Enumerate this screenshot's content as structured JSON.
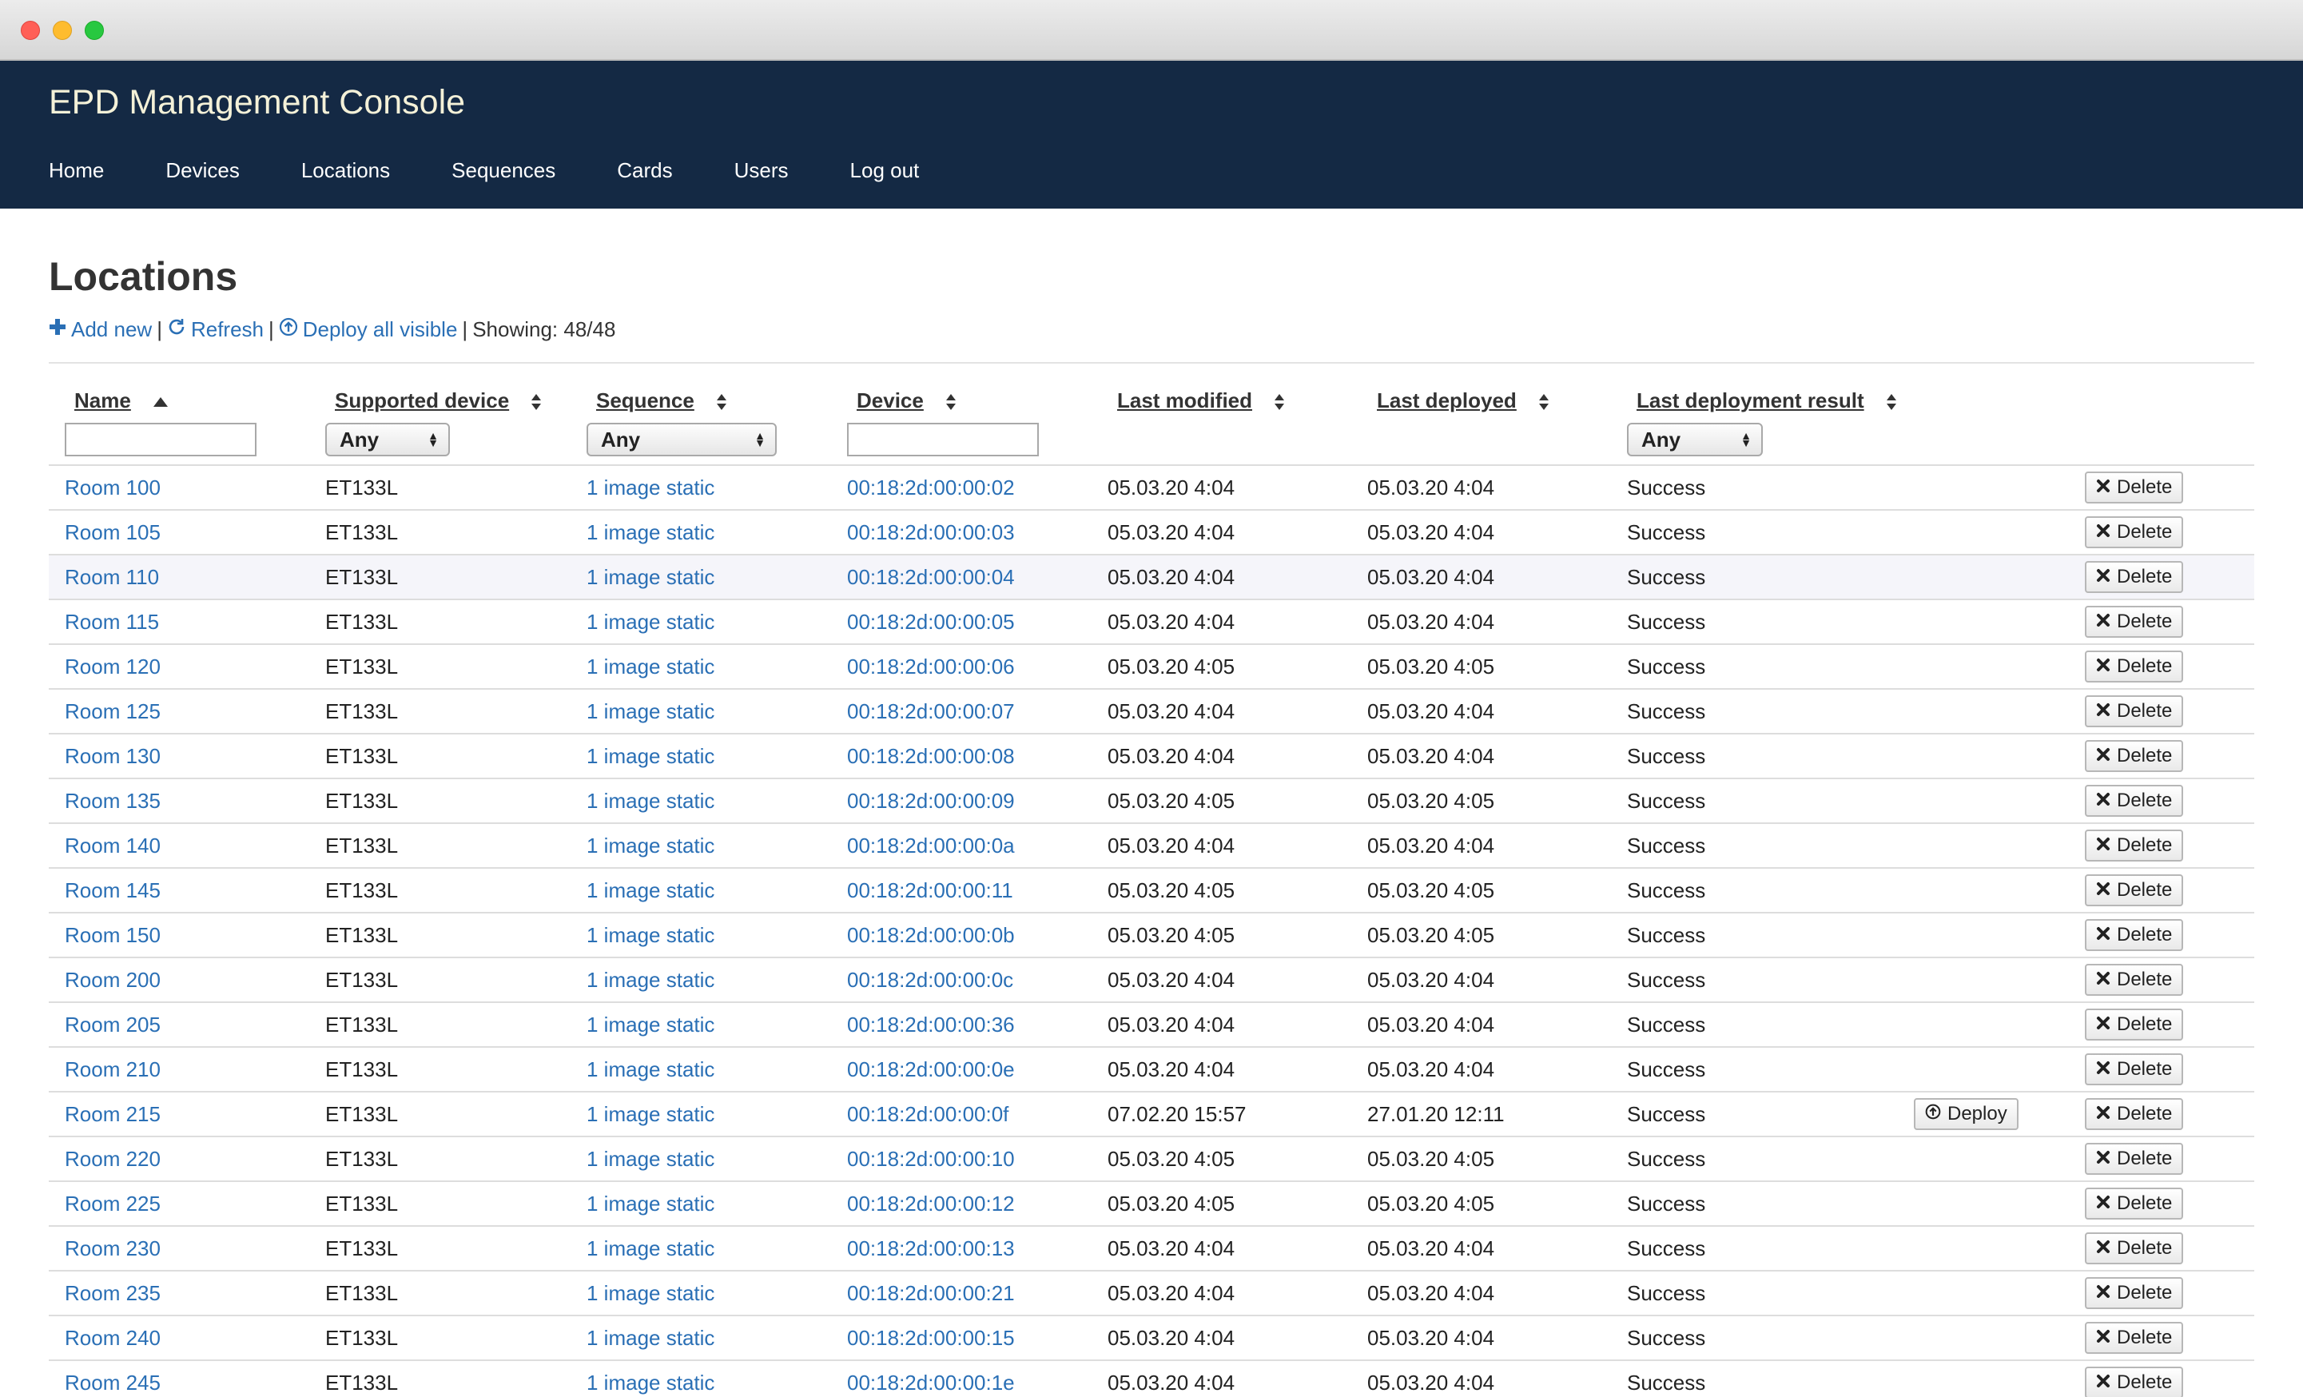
{
  "app": {
    "title": "EPD Management Console"
  },
  "nav": {
    "items": [
      {
        "label": "Home"
      },
      {
        "label": "Devices"
      },
      {
        "label": "Locations"
      },
      {
        "label": "Sequences"
      },
      {
        "label": "Cards"
      },
      {
        "label": "Users"
      },
      {
        "label": "Log out"
      }
    ]
  },
  "page": {
    "title": "Locations"
  },
  "toolbar": {
    "add_new": "Add new",
    "refresh": "Refresh",
    "deploy_all": "Deploy all visible",
    "showing": "Showing: 48/48",
    "separator": "|"
  },
  "icons": {
    "add": "plus-icon",
    "refresh": "refresh-icon",
    "deploy": "upload-circle-icon",
    "delete": "x-mark-icon",
    "sort": "sort-icon",
    "sort_asc": "sort-ascending-icon"
  },
  "colors": {
    "header_bg": "#142944",
    "link": "#2a6fb5",
    "success": "#1a8a1a",
    "brand_text": "#f4f1d8"
  },
  "table": {
    "columns": [
      {
        "label": "Name"
      },
      {
        "label": "Supported device"
      },
      {
        "label": "Sequence"
      },
      {
        "label": "Device"
      },
      {
        "label": "Last modified"
      },
      {
        "label": "Last deployed"
      },
      {
        "label": "Last deployment result"
      }
    ],
    "filters": {
      "name_value": "",
      "supported_device_selected": "Any",
      "sequence_selected": "Any",
      "device_value": "",
      "result_selected": "Any"
    },
    "actions": {
      "delete_label": "Delete",
      "deploy_label": "Deploy"
    },
    "rows": [
      {
        "name": "Room 100",
        "supported": "ET133L",
        "sequence": "1 image static",
        "device": "00:18:2d:00:00:02",
        "modified": "05.03.20 4:04",
        "deployed": "05.03.20 4:04",
        "result": "Success",
        "deploy": false
      },
      {
        "name": "Room 105",
        "supported": "ET133L",
        "sequence": "1 image static",
        "device": "00:18:2d:00:00:03",
        "modified": "05.03.20 4:04",
        "deployed": "05.03.20 4:04",
        "result": "Success",
        "deploy": false
      },
      {
        "name": "Room 110",
        "supported": "ET133L",
        "sequence": "1 image static",
        "device": "00:18:2d:00:00:04",
        "modified": "05.03.20 4:04",
        "deployed": "05.03.20 4:04",
        "result": "Success",
        "deploy": false
      },
      {
        "name": "Room 115",
        "supported": "ET133L",
        "sequence": "1 image static",
        "device": "00:18:2d:00:00:05",
        "modified": "05.03.20 4:04",
        "deployed": "05.03.20 4:04",
        "result": "Success",
        "deploy": false
      },
      {
        "name": "Room 120",
        "supported": "ET133L",
        "sequence": "1 image static",
        "device": "00:18:2d:00:00:06",
        "modified": "05.03.20 4:05",
        "deployed": "05.03.20 4:05",
        "result": "Success",
        "deploy": false
      },
      {
        "name": "Room 125",
        "supported": "ET133L",
        "sequence": "1 image static",
        "device": "00:18:2d:00:00:07",
        "modified": "05.03.20 4:04",
        "deployed": "05.03.20 4:04",
        "result": "Success",
        "deploy": false
      },
      {
        "name": "Room 130",
        "supported": "ET133L",
        "sequence": "1 image static",
        "device": "00:18:2d:00:00:08",
        "modified": "05.03.20 4:04",
        "deployed": "05.03.20 4:04",
        "result": "Success",
        "deploy": false
      },
      {
        "name": "Room 135",
        "supported": "ET133L",
        "sequence": "1 image static",
        "device": "00:18:2d:00:00:09",
        "modified": "05.03.20 4:05",
        "deployed": "05.03.20 4:05",
        "result": "Success",
        "deploy": false
      },
      {
        "name": "Room 140",
        "supported": "ET133L",
        "sequence": "1 image static",
        "device": "00:18:2d:00:00:0a",
        "modified": "05.03.20 4:04",
        "deployed": "05.03.20 4:04",
        "result": "Success",
        "deploy": false
      },
      {
        "name": "Room 145",
        "supported": "ET133L",
        "sequence": "1 image static",
        "device": "00:18:2d:00:00:11",
        "modified": "05.03.20 4:05",
        "deployed": "05.03.20 4:05",
        "result": "Success",
        "deploy": false
      },
      {
        "name": "Room 150",
        "supported": "ET133L",
        "sequence": "1 image static",
        "device": "00:18:2d:00:00:0b",
        "modified": "05.03.20 4:05",
        "deployed": "05.03.20 4:05",
        "result": "Success",
        "deploy": false
      },
      {
        "name": "Room 200",
        "supported": "ET133L",
        "sequence": "1 image static",
        "device": "00:18:2d:00:00:0c",
        "modified": "05.03.20 4:04",
        "deployed": "05.03.20 4:04",
        "result": "Success",
        "deploy": false
      },
      {
        "name": "Room 205",
        "supported": "ET133L",
        "sequence": "1 image static",
        "device": "00:18:2d:00:00:36",
        "modified": "05.03.20 4:04",
        "deployed": "05.03.20 4:04",
        "result": "Success",
        "deploy": false
      },
      {
        "name": "Room 210",
        "supported": "ET133L",
        "sequence": "1 image static",
        "device": "00:18:2d:00:00:0e",
        "modified": "05.03.20 4:04",
        "deployed": "05.03.20 4:04",
        "result": "Success",
        "deploy": false
      },
      {
        "name": "Room 215",
        "supported": "ET133L",
        "sequence": "1 image static",
        "device": "00:18:2d:00:00:0f",
        "modified": "07.02.20 15:57",
        "deployed": "27.01.20 12:11",
        "result": "Success",
        "deploy": true
      },
      {
        "name": "Room 220",
        "supported": "ET133L",
        "sequence": "1 image static",
        "device": "00:18:2d:00:00:10",
        "modified": "05.03.20 4:05",
        "deployed": "05.03.20 4:05",
        "result": "Success",
        "deploy": false
      },
      {
        "name": "Room 225",
        "supported": "ET133L",
        "sequence": "1 image static",
        "device": "00:18:2d:00:00:12",
        "modified": "05.03.20 4:05",
        "deployed": "05.03.20 4:05",
        "result": "Success",
        "deploy": false
      },
      {
        "name": "Room 230",
        "supported": "ET133L",
        "sequence": "1 image static",
        "device": "00:18:2d:00:00:13",
        "modified": "05.03.20 4:04",
        "deployed": "05.03.20 4:04",
        "result": "Success",
        "deploy": false
      },
      {
        "name": "Room 235",
        "supported": "ET133L",
        "sequence": "1 image static",
        "device": "00:18:2d:00:00:21",
        "modified": "05.03.20 4:04",
        "deployed": "05.03.20 4:04",
        "result": "Success",
        "deploy": false
      },
      {
        "name": "Room 240",
        "supported": "ET133L",
        "sequence": "1 image static",
        "device": "00:18:2d:00:00:15",
        "modified": "05.03.20 4:04",
        "deployed": "05.03.20 4:04",
        "result": "Success",
        "deploy": false
      },
      {
        "name": "Room 245",
        "supported": "ET133L",
        "sequence": "1 image static",
        "device": "00:18:2d:00:00:1e",
        "modified": "05.03.20 4:04",
        "deployed": "05.03.20 4:04",
        "result": "Success",
        "deploy": false
      }
    ]
  }
}
